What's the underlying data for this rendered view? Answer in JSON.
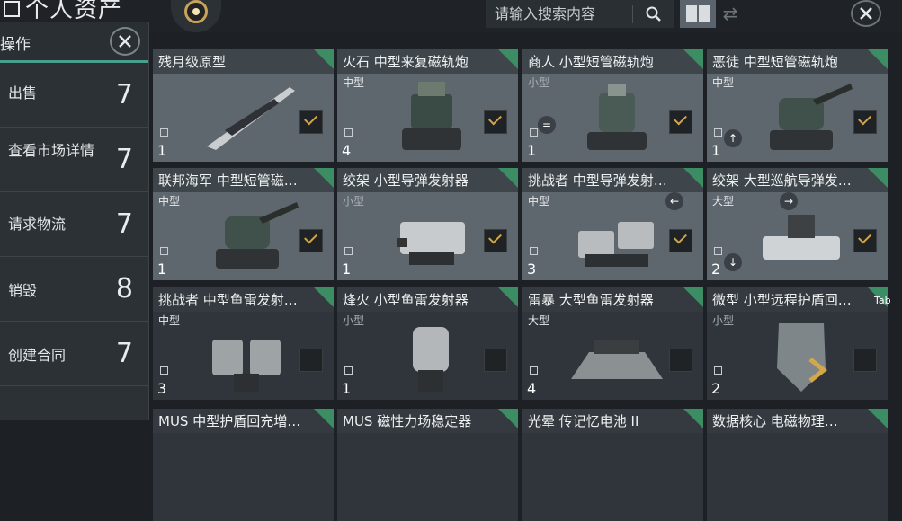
{
  "title": "个人资产",
  "search": {
    "placeholder": "请输入搜索内容"
  },
  "panel": {
    "title": "操作",
    "items": [
      {
        "label": "出售",
        "key": "7"
      },
      {
        "label": "查看市场详情",
        "key": "7"
      },
      {
        "label": "请求物流",
        "key": "7"
      },
      {
        "label": "销毁",
        "key": "8"
      },
      {
        "label": "创建合同",
        "key": "7"
      }
    ]
  },
  "cards": [
    {
      "name": "残月级原型",
      "size": "",
      "count": "1",
      "checked": true
    },
    {
      "name": "火石 中型来复磁轨炮",
      "size": "中型",
      "count": "4",
      "checked": true
    },
    {
      "name": "商人 小型短管磁轨炮",
      "size": "小型",
      "count": "1",
      "checked": true
    },
    {
      "name": "恶徒 中型短管磁轨炮",
      "size": "中型",
      "count": "1",
      "checked": true
    },
    {
      "name": "联邦海军 中型短管磁…",
      "size": "中型",
      "count": "1",
      "checked": true
    },
    {
      "name": "绞架 小型导弹发射器",
      "size": "小型",
      "count": "1",
      "checked": true
    },
    {
      "name": "挑战者 中型导弹发射…",
      "size": "中型",
      "count": "3",
      "checked": true
    },
    {
      "name": "绞架 大型巡航导弹发…",
      "size": "大型",
      "count": "2",
      "checked": true
    },
    {
      "name": "挑战者 中型鱼雷发射…",
      "size": "中型",
      "count": "3",
      "checked": false
    },
    {
      "name": "烽火 小型鱼雷发射器",
      "size": "小型",
      "count": "1",
      "checked": false
    },
    {
      "name": "雷暴 大型鱼雷发射器",
      "size": "大型",
      "count": "4",
      "checked": false
    },
    {
      "name": "微型 小型远程护盾回…",
      "size": "小型",
      "count": "2",
      "checked": false
    },
    {
      "name": "MUS 中型护盾回充増…",
      "size": "",
      "count": "",
      "checked": false
    },
    {
      "name": "MUS 磁性力场稳定器",
      "size": "",
      "count": "",
      "checked": false
    },
    {
      "name": "光晕 传记忆电池 II",
      "size": "",
      "count": "",
      "checked": false
    },
    {
      "name": "数据核心 电磁物理…",
      "size": "",
      "count": "",
      "checked": false
    }
  ],
  "hints": {
    "equals": "=",
    "up": "↑",
    "left": "←",
    "right": "→",
    "down": "↓",
    "tab": "Tab"
  },
  "icons": [
    "search-icon",
    "close-icon",
    "grid-view-icon",
    "swap-icon",
    "checkbox-icon"
  ],
  "colors": {
    "accent": "#4a9e8c",
    "corner": "#3d8d64",
    "check": "#d3a64a"
  }
}
